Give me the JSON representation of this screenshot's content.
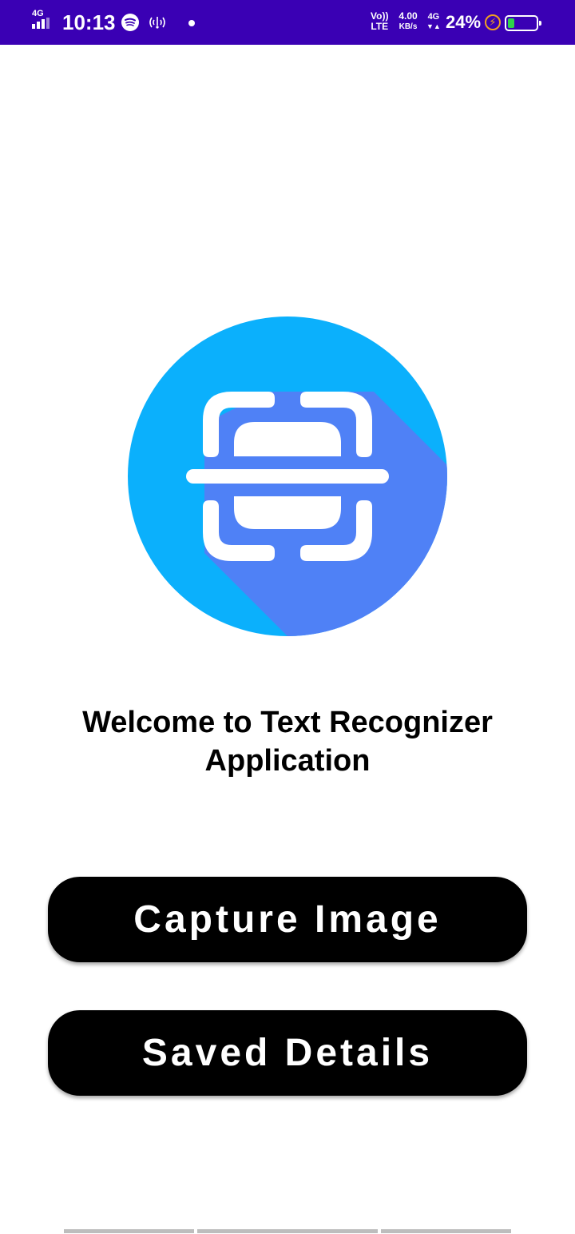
{
  "status_bar": {
    "network_small": "4G",
    "time": "10:13",
    "volte_top": "Vo))",
    "volte_bottom": "LTE",
    "speed_value": "4.00",
    "speed_unit": "KB/s",
    "network_type": "4G",
    "network_arrows": "▼▲",
    "battery_percent": "24%",
    "battery_level": 0.24,
    "icons": [
      "signal-icon",
      "spotify-icon",
      "hotspot-icon",
      "notification-dot-icon",
      "charging-icon",
      "battery-icon"
    ]
  },
  "logo": {
    "icon": "text-scanner-icon",
    "colors": {
      "circle": "#0bb0fc",
      "shadow": "#4f81f6",
      "glyph": "#ffffff"
    }
  },
  "welcome": {
    "line1": "Welcome to Text Recognizer",
    "line2": "Application"
  },
  "buttons": {
    "capture_label": "Capture Image",
    "saved_label": "Saved Details"
  }
}
